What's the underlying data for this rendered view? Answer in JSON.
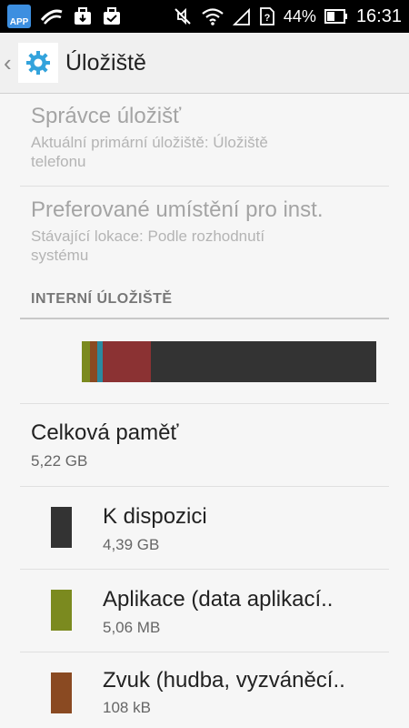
{
  "status_bar": {
    "app_badge": "APP",
    "battery_percent": "44%",
    "time": "16:31"
  },
  "action_bar": {
    "title": "Úložiště"
  },
  "prefs": [
    {
      "title": "Správce úložišť",
      "summary_line1": "Aktuální primární úložiště: Úložiště",
      "summary_line2": "telefonu"
    },
    {
      "title": "Preferované umístění pro inst.",
      "summary_line1": "Stávající lokace: Podle rozhodnutí",
      "summary_line2": "systému"
    }
  ],
  "section": {
    "header": "INTERNÍ ÚLOŽIŠTĚ"
  },
  "usage_bar": {
    "segments": [
      {
        "name": "apps",
        "color": "#7b8a1f",
        "fraction": 0.027
      },
      {
        "name": "audio",
        "color": "#8a4a22",
        "fraction": 0.025
      },
      {
        "name": "other-blue",
        "color": "#2a8aa0",
        "fraction": 0.018
      },
      {
        "name": "misc",
        "color": "#8b3233",
        "fraction": 0.165
      },
      {
        "name": "available",
        "color": "#333333",
        "fraction": 0.765
      }
    ]
  },
  "total": {
    "title": "Celková paměť",
    "value": "5,22 GB"
  },
  "items": [
    {
      "title": "K dispozici",
      "value": "4,39 GB",
      "color": "#333333"
    },
    {
      "title": "Aplikace (data aplikací..",
      "value": "5,06 MB",
      "color": "#7b8a1f"
    },
    {
      "title": "Zvuk (hudba, vyzváněcí..",
      "value": "108 kB",
      "color": "#8a4a22"
    }
  ]
}
